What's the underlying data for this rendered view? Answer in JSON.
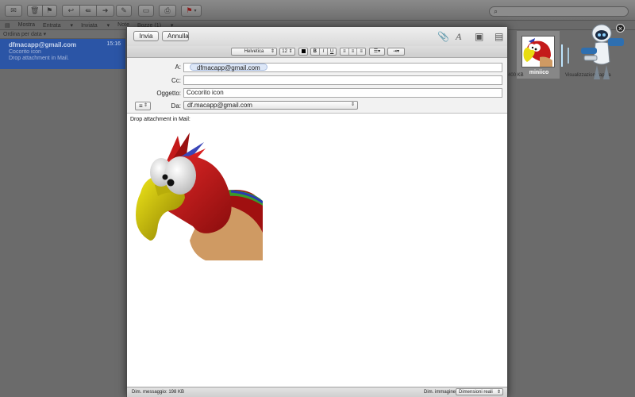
{
  "main_window": {
    "favorites": [
      "Mostra",
      "Entrata",
      "Inviata",
      "Note",
      "Bozze (1)"
    ],
    "sort_label": "Ordina per data",
    "message": {
      "from": "dfmacapp@gmail.com",
      "time": "15:16",
      "subject": "Cocorito icon",
      "preview": "Drop attachment in Mail."
    }
  },
  "compose": {
    "send_label": "Invia",
    "cancel_label": "Annulla",
    "font_name": "Helvetica",
    "font_size": "12",
    "to_label": "A:",
    "to_value": "dfmacapp@gmail.com",
    "cc_label": "Cc:",
    "cc_value": "",
    "subject_label": "Oggetto:",
    "subject_value": "Cocorito icon",
    "from_label": "Da:",
    "from_value": "df.macapp@gmail.com",
    "body_text": "Drop attachment in Mail:",
    "message_size_label": "Dim. messaggio: 198 KB",
    "image_size_label": "Dim. immagine:",
    "image_size_value": "Dimensioni reali"
  },
  "side_panel": {
    "mini_label": "miniico",
    "left_caption": "400 KB",
    "right_caption": "Visualizzazioni rapida"
  },
  "colors": {
    "selection_blue": "#2b55a6",
    "parrot_red": "#b81414",
    "parrot_beak": "#d8cc00"
  }
}
